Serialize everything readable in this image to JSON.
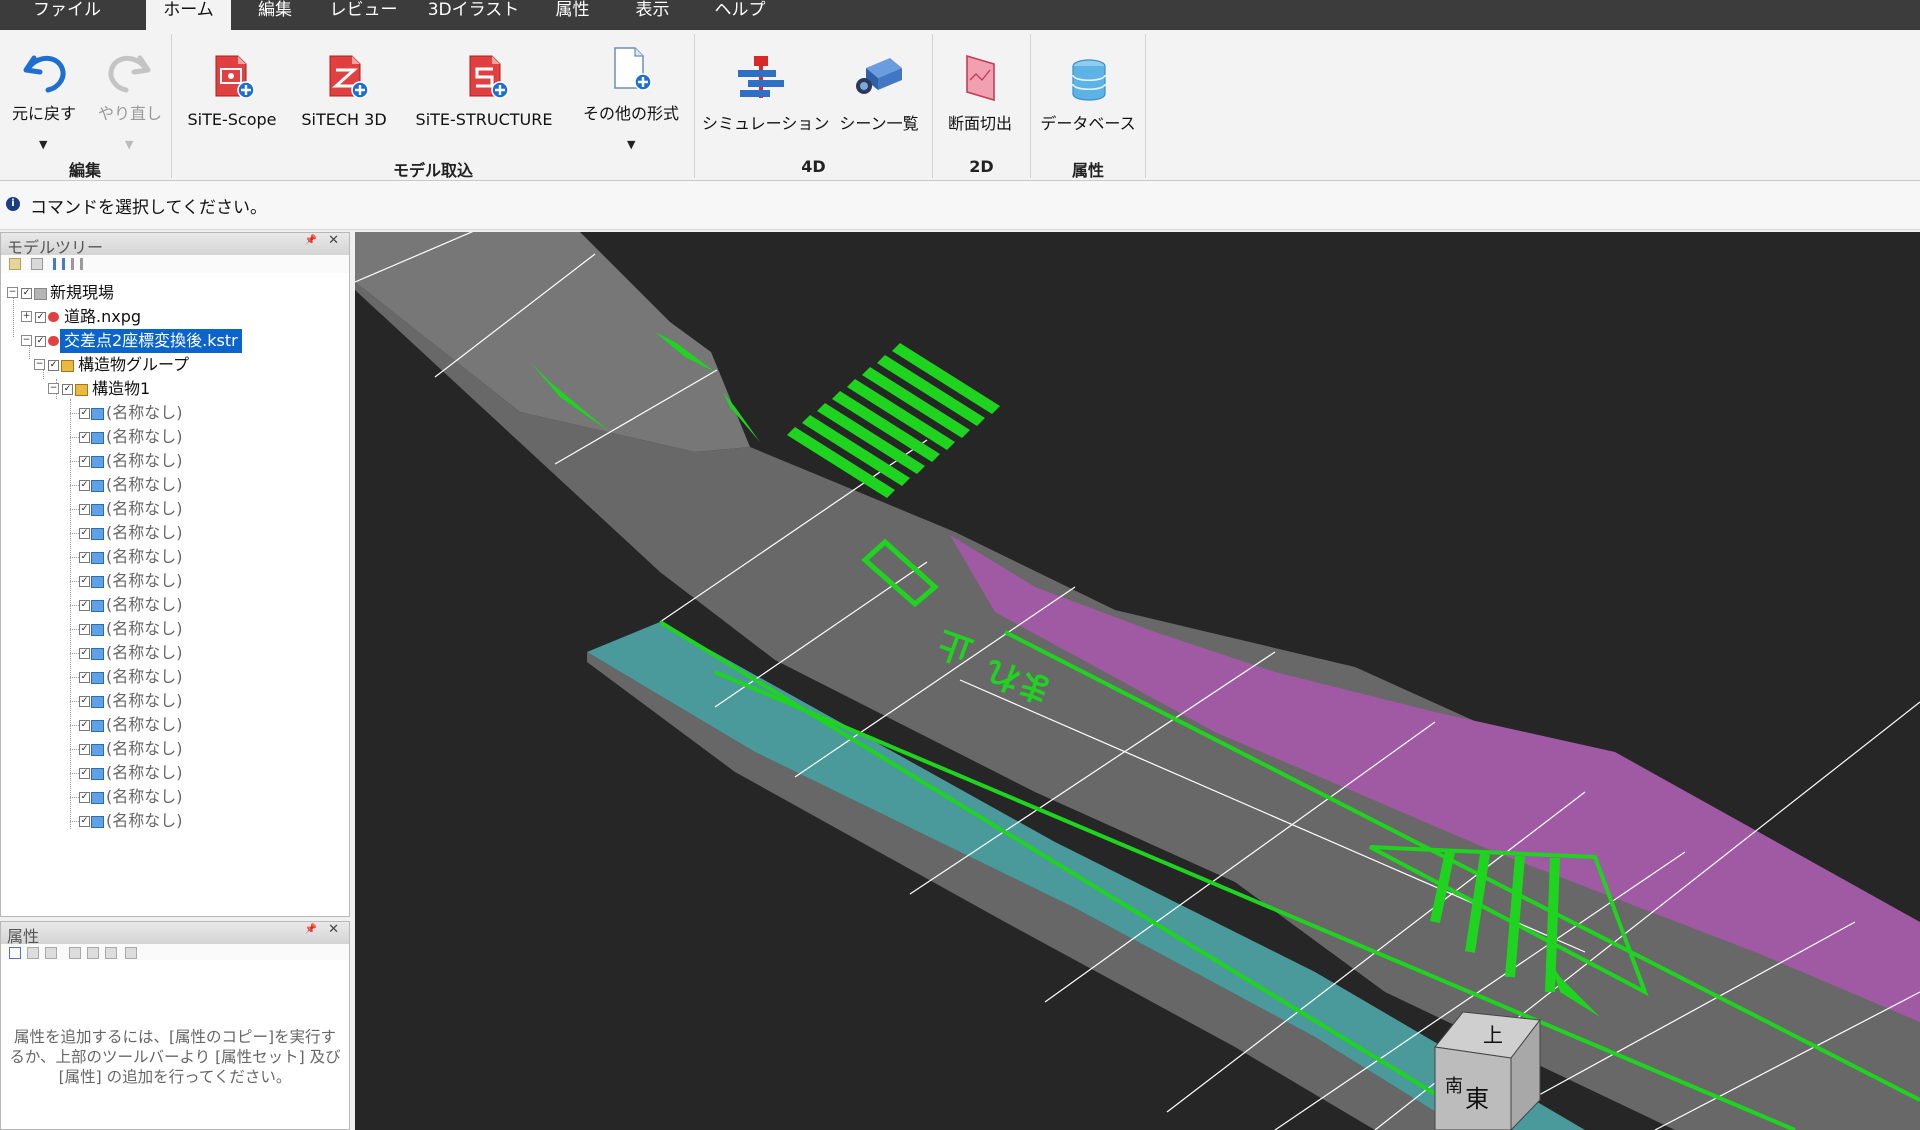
{
  "menu": {
    "tabs": [
      {
        "label": "ファイル"
      },
      {
        "label": "ホーム"
      },
      {
        "label": "編集"
      },
      {
        "label": "レビュー"
      },
      {
        "label": "3Dイラスト"
      },
      {
        "label": "属性"
      },
      {
        "label": "表示"
      },
      {
        "label": "ヘルプ"
      }
    ],
    "active_tab": "ホーム"
  },
  "ribbon": {
    "edit": {
      "undo_label": "元に戻す",
      "redo_label": "やり直し",
      "group_label": "編集"
    },
    "model_import": {
      "site_scope_label": "SiTE-Scope",
      "sitech3d_label": "SiTECH 3D",
      "site_structure_label": "SiTE-STRUCTURE",
      "other_format_label": "その他の形式",
      "group_label": "モデル取込"
    },
    "fourd": {
      "simulation_label": "シミュレーション",
      "scene_list_label": "シーン一覧",
      "group_label": "4D"
    },
    "twod": {
      "section_cut_label": "断面切出",
      "group_label": "2D"
    },
    "attr": {
      "database_label": "データベース",
      "group_label": "属性"
    }
  },
  "command_bar": {
    "message": "コマンドを選択してください。"
  },
  "model_tree": {
    "title": "モデルツリー",
    "root_label": "新規現場",
    "road_file": "道路.nxpg",
    "selected_file": "交差点2座標変換後.kstr",
    "group_label": "構造物グループ",
    "structure_label": "構造物1",
    "unnamed_items": [
      "(名称なし)",
      "(名称なし)",
      "(名称なし)",
      "(名称なし)",
      "(名称なし)",
      "(名称なし)",
      "(名称なし)",
      "(名称なし)",
      "(名称なし)",
      "(名称なし)",
      "(名称なし)",
      "(名称なし)",
      "(名称なし)",
      "(名称なし)",
      "(名称なし)",
      "(名称なし)",
      "(名称なし)",
      "(名称なし)"
    ]
  },
  "attributes_panel": {
    "title": "属性",
    "message": "属性を追加するには、[属性のコピー]を実行するか、上部のツールバーより [属性セット] 及び [属性] の追加を行ってください。"
  },
  "viewcube": {
    "top": "上",
    "south": "南",
    "east": "東"
  },
  "road_markings": {
    "text_1": "止",
    "text_2": "まれ"
  },
  "colors": {
    "road_marking": "#1fd41f",
    "road_surface": "#6e6e6e",
    "sidewalk_left": "#4a9a9c",
    "slope_right": "#a05aa4",
    "selection": "#0a64c9",
    "viewport_bg": "#262626"
  }
}
